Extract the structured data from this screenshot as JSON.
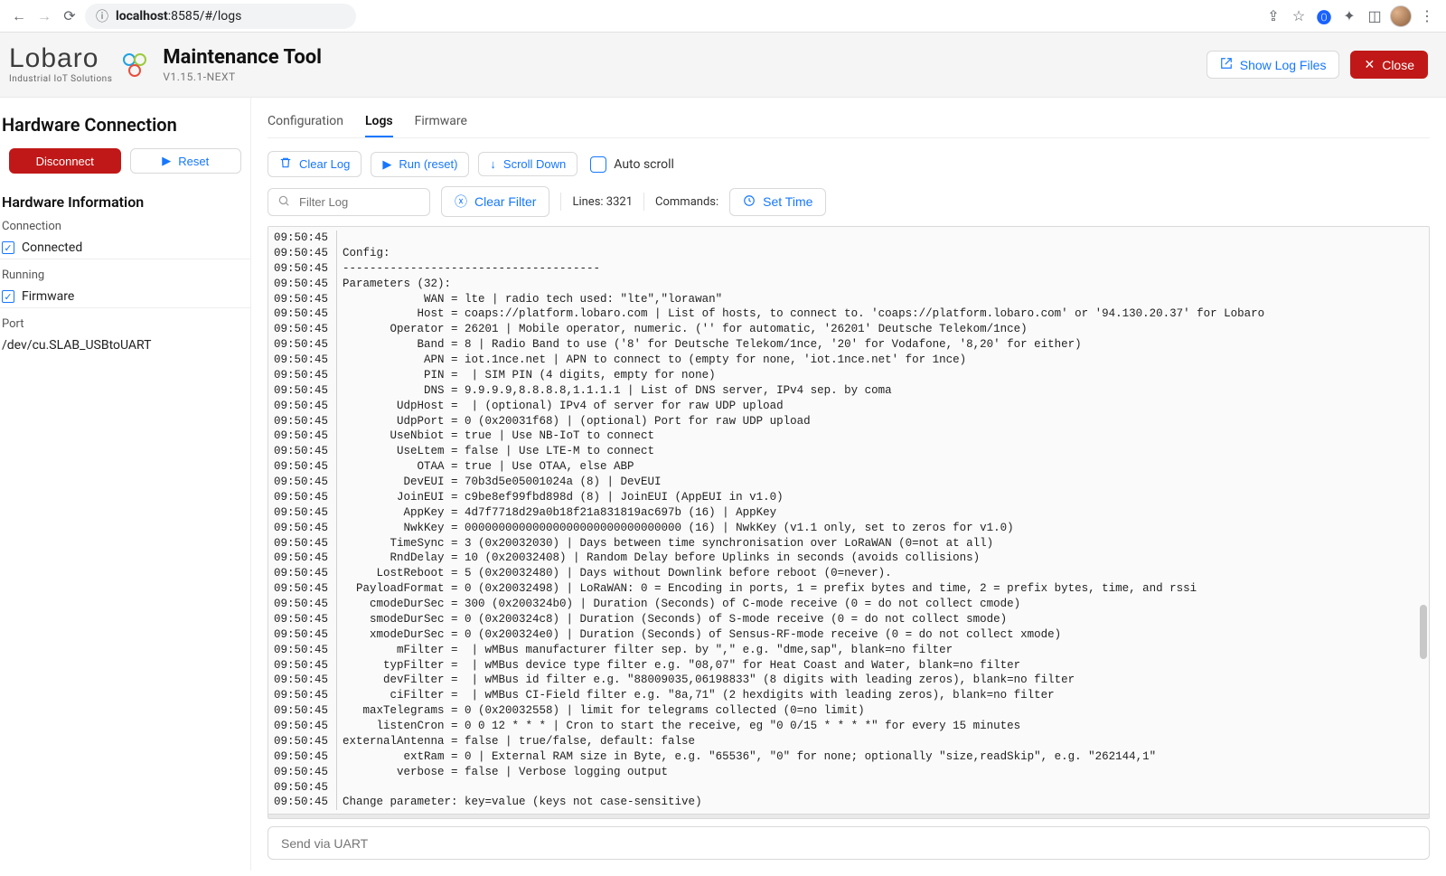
{
  "browser": {
    "url_host": "localhost",
    "url_port_path": ":8585/#/logs"
  },
  "app": {
    "logo_name": "Lobaro",
    "logo_sub": "Industrial IoT Solutions",
    "title": "Maintenance Tool",
    "version": "V1.15.1-NEXT"
  },
  "header_actions": {
    "show_log_files": "Show Log Files",
    "close": "Close"
  },
  "sidebar": {
    "title": "Hardware Connection",
    "disconnect": "Disconnect",
    "reset": "Reset",
    "hw_info_title": "Hardware Information",
    "connection_label": "Connection",
    "connection_value": "Connected",
    "running_label": "Running",
    "running_value": "Firmware",
    "port_label": "Port",
    "port_value": "/dev/cu.SLAB_USBtoUART"
  },
  "tabs": {
    "configuration": "Configuration",
    "logs": "Logs",
    "firmware": "Firmware",
    "active": "logs"
  },
  "toolbar": {
    "clear_log": "Clear Log",
    "run_reset": "Run (reset)",
    "scroll_down": "Scroll Down",
    "auto_scroll": "Auto scroll"
  },
  "filter": {
    "placeholder": "Filter Log",
    "clear_filter": "Clear Filter",
    "lines_label": "Lines:",
    "lines_value": "3321",
    "commands_label": "Commands:",
    "set_time": "Set Time"
  },
  "send": {
    "placeholder": "Send via UART"
  },
  "timestamp": "09:50:45",
  "log_lines_raw": [
    "",
    "Config:",
    "--------------------------------------",
    "Parameters (32):",
    "            WAN = lte | radio tech used: \"lte\",\"lorawan\"",
    "           Host = coaps://platform.lobaro.com | List of hosts, to connect to. 'coaps://platform.lobaro.com' or '94.130.20.37' for Lobaro",
    "       Operator = 26201 | Mobile operator, numeric. ('' for automatic, '26201' Deutsche Telekom/1nce)",
    "           Band = 8 | Radio Band to use ('8' for Deutsche Telekom/1nce, '20' for Vodafone, '8,20' for either)",
    "            APN = iot.1nce.net | APN to connect to (empty for none, 'iot.1nce.net' for 1nce)",
    "            PIN =  | SIM PIN (4 digits, empty for none)",
    "            DNS = 9.9.9.9,8.8.8.8,1.1.1.1 | List of DNS server, IPv4 sep. by coma",
    "        UdpHost =  | (optional) IPv4 of server for raw UDP upload",
    "        UdpPort = 0 (0x20031f68) | (optional) Port for raw UDP upload",
    "       UseNbiot = true | Use NB-IoT to connect",
    "        UseLtem = false | Use LTE-M to connect",
    "           OTAA = true | Use OTAA, else ABP",
    "         DevEUI = 70b3d5e05001024a (8) | DevEUI",
    "        JoinEUI = c9be8ef99fbd898d (8) | JoinEUI (AppEUI in v1.0)",
    "         AppKey = 4d7f7718d29a0b18f21a831819ac697b (16) | AppKey",
    "         NwkKey = 00000000000000000000000000000000 (16) | NwkKey (v1.1 only, set to zeros for v1.0)",
    "       TimeSync = 3 (0x20032030) | Days between time synchronisation over LoRaWAN (0=not at all)",
    "       RndDelay = 10 (0x20032408) | Random Delay before Uplinks in seconds (avoids collisions)",
    "     LostReboot = 5 (0x20032480) | Days without Downlink before reboot (0=never).",
    "  PayloadFormat = 0 (0x20032498) | LoRaWAN: 0 = Encoding in ports, 1 = prefix bytes and time, 2 = prefix bytes, time, and rssi",
    "    cmodeDurSec = 300 (0x200324b0) | Duration (Seconds) of C-mode receive (0 = do not collect cmode)",
    "    smodeDurSec = 0 (0x200324c8) | Duration (Seconds) of S-mode receive (0 = do not collect smode)",
    "    xmodeDurSec = 0 (0x200324e0) | Duration (Seconds) of Sensus-RF-mode receive (0 = do not collect xmode)",
    "        mFilter =  | wMBus manufacturer filter sep. by \",\" e.g. \"dme,sap\", blank=no filter",
    "      typFilter =  | wMBus device type filter e.g. \"08,07\" for Heat Coast and Water, blank=no filter",
    "      devFilter =  | wMBus id filter e.g. \"88009035,06198833\" (8 digits with leading zeros), blank=no filter",
    "       ciFilter =  | wMBus CI-Field filter e.g. \"8a,71\" (2 hexdigits with leading zeros), blank=no filter",
    "   maxTelegrams = 0 (0x20032558) | limit for telegrams collected (0=no limit)",
    "     listenCron = 0 0 12 * * * | Cron to start the receive, eg \"0 0/15 * * * *\" for every 15 minutes",
    "externalAntenna = false | true/false, default: false",
    "         extRam = 0 | External RAM size in Byte, e.g. \"65536\", \"0\" for none; optionally \"size,readSkip\", e.g. \"262144,1\"",
    "        verbose = false | Verbose logging output",
    "",
    "Change parameter: key=value (keys not case-sensitive)"
  ]
}
